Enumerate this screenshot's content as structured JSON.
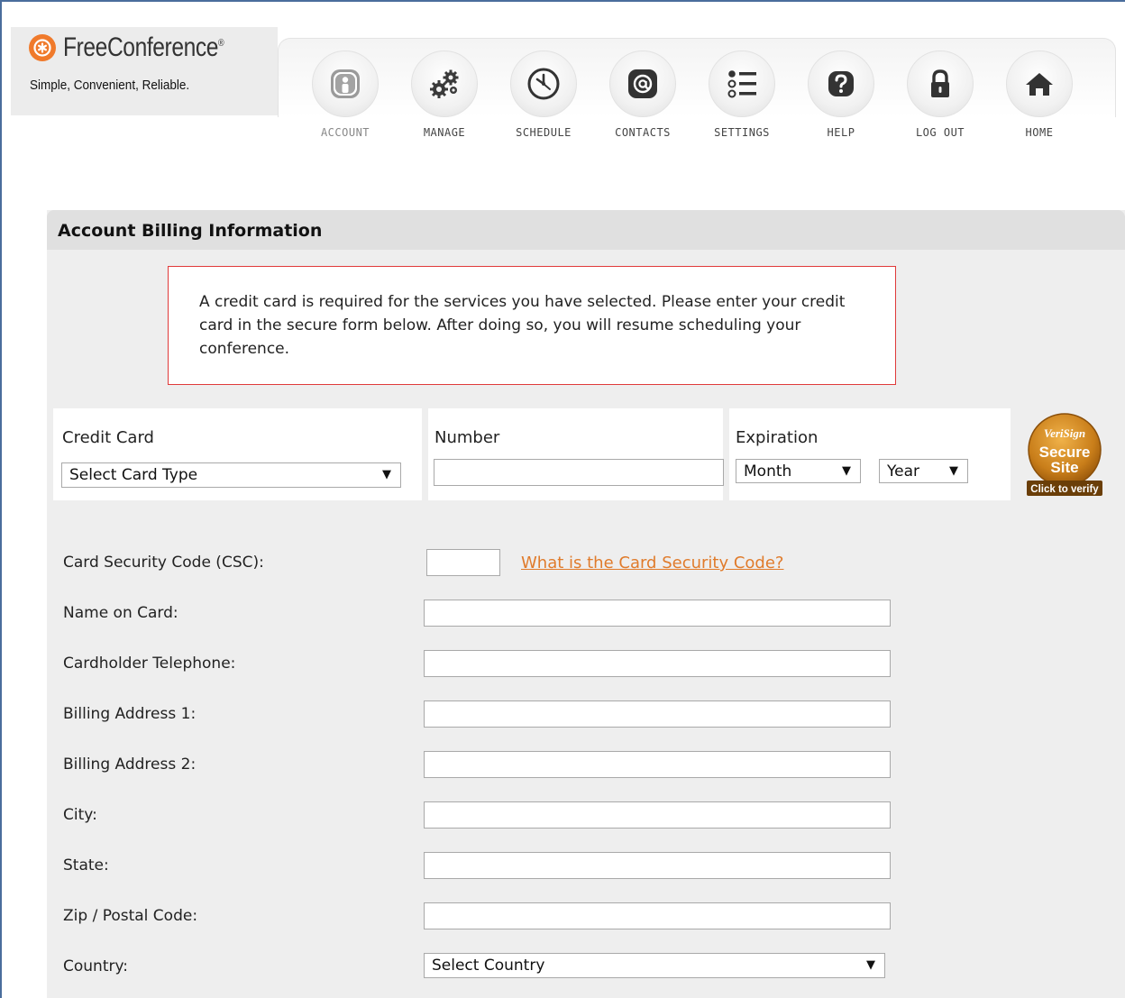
{
  "brand": {
    "name": "FreeConference",
    "trademark": "®",
    "tagline": "Simple, Convenient, Reliable."
  },
  "nav": {
    "items": [
      {
        "label": "ACCOUNT",
        "icon": "account-icon",
        "active": true
      },
      {
        "label": "MANAGE",
        "icon": "gears-icon"
      },
      {
        "label": "SCHEDULE",
        "icon": "clock-icon"
      },
      {
        "label": "CONTACTS",
        "icon": "at-sign-icon"
      },
      {
        "label": "SETTINGS",
        "icon": "list-icon"
      },
      {
        "label": "HELP",
        "icon": "question-icon"
      },
      {
        "label": "LOG OUT",
        "icon": "lock-icon"
      },
      {
        "label": "HOME",
        "icon": "home-icon"
      }
    ]
  },
  "panel": {
    "title": "Account Billing Information",
    "notice": "A credit card is required for the services you have selected. Please enter your credit card in the secure form below. After doing so, you will resume scheduling your conference."
  },
  "card": {
    "credit_card_label": "Credit Card",
    "card_type_selected": "Select Card Type",
    "number_label": "Number",
    "number_value": "",
    "expiration_label": "Expiration",
    "month_selected": "Month",
    "year_selected": "Year"
  },
  "seal": {
    "line1": "VeriSign",
    "line2": "Secure",
    "line3": "Site",
    "line4": "Click to verify"
  },
  "form": {
    "csc_label": "Card Security Code (CSC):",
    "csc_value": "",
    "csc_help_link": "What is the Card Security Code?",
    "name_label": "Name on Card:",
    "name_value": "",
    "phone_label": "Cardholder Telephone:",
    "phone_value": "",
    "address1_label": "Billing Address 1:",
    "address1_value": "",
    "address2_label": "Billing Address 2:",
    "address2_value": "",
    "city_label": "City:",
    "city_value": "",
    "state_label": "State:",
    "state_value": "",
    "zip_label": "Zip / Postal Code:",
    "zip_value": "",
    "country_label": "Country:",
    "country_selected": "Select Country"
  },
  "colors": {
    "accent": "#f07a2b",
    "link": "#e07b2b",
    "notice_border": "#e03a3a",
    "panel_bg": "#eeeeee"
  }
}
